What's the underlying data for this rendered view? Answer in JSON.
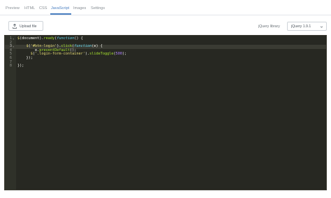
{
  "tabs": [
    {
      "label": "Preview",
      "active": false
    },
    {
      "label": "HTML",
      "active": false
    },
    {
      "label": "CSS",
      "active": false
    },
    {
      "label": "JavaScript",
      "active": true
    },
    {
      "label": "Images",
      "active": false
    },
    {
      "label": "Settings",
      "active": false
    }
  ],
  "toolbar": {
    "upload_label": "Upload file",
    "upload_icon": "upload-icon",
    "library_label": "jQuery library",
    "library_selected": "jQuery 1.9.1",
    "library_icon": "chevron-down-icon"
  },
  "editor": {
    "theme": "monokai",
    "active_line": 3,
    "lines": [
      {
        "n": "1",
        "fold": true,
        "text": "$(document).ready(function() {"
      },
      {
        "n": "2",
        "fold": false,
        "text": ""
      },
      {
        "n": "3",
        "fold": true,
        "text": "    $('#btn-login').click(function(e) {"
      },
      {
        "n": "4",
        "fold": false,
        "text": "        e.preventDefault();"
      },
      {
        "n": "5",
        "fold": false,
        "text": "      $('.login-form-container').slideToggle(500);"
      },
      {
        "n": "6",
        "fold": false,
        "text": "    });"
      },
      {
        "n": "7",
        "fold": false,
        "text": ""
      },
      {
        "n": "8",
        "fold": false,
        "text": "});"
      }
    ]
  },
  "colors": {
    "accent": "#4a7fc1",
    "editor_bg": "#272822",
    "editor_text": "#f8f8f2"
  }
}
